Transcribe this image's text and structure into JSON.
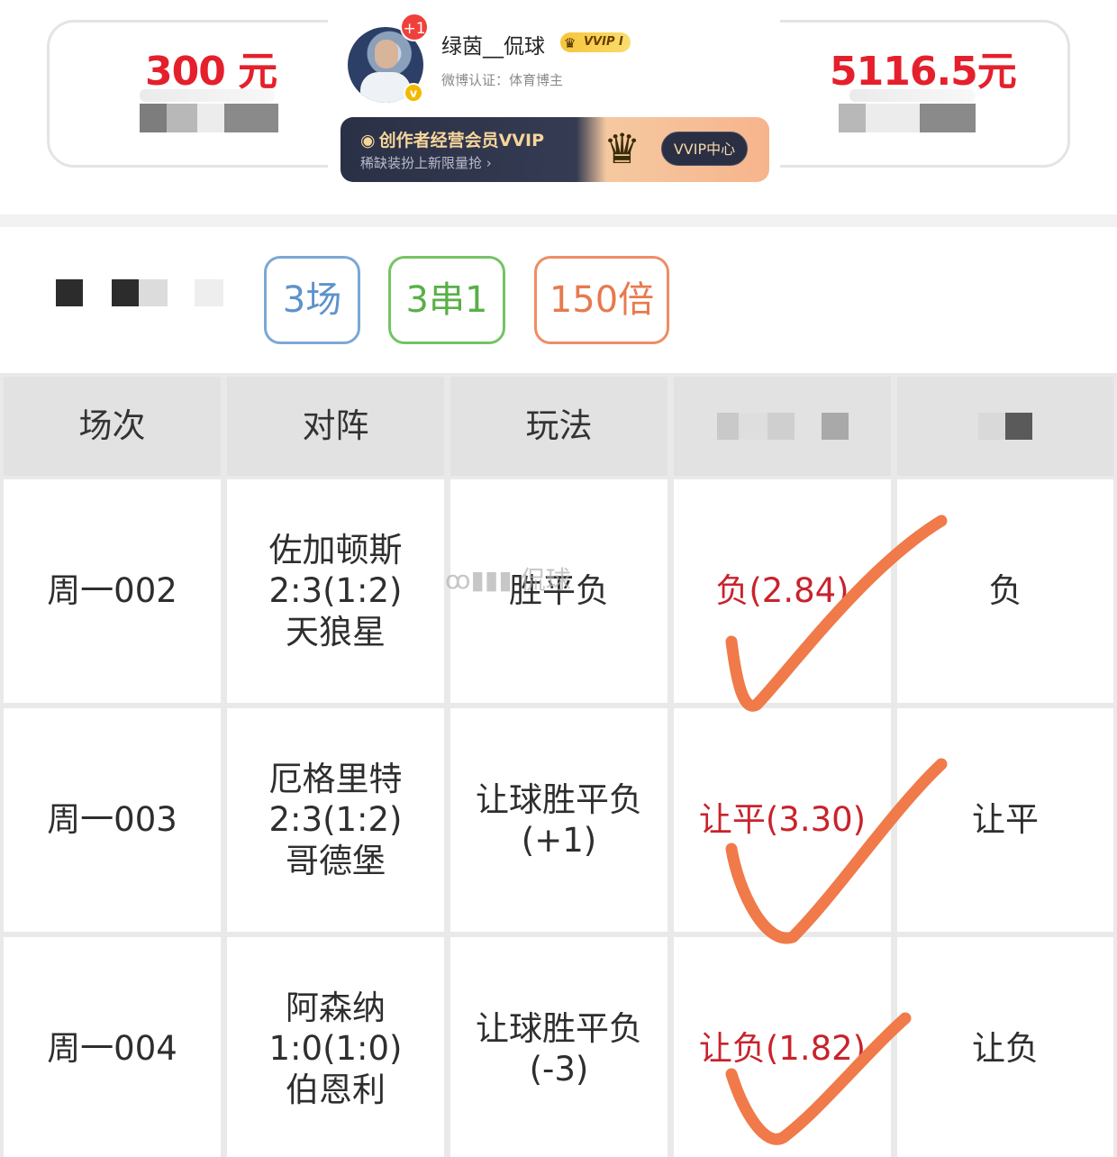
{
  "stats": {
    "left_value": "300 元",
    "right_value": "5116.5元"
  },
  "profile": {
    "username": "绿茵__侃球",
    "notification_count": "+1",
    "vvip_badge": "VVIP I",
    "verification": "微博认证：体育博主",
    "banner_title": "创作者经营会员VVIP",
    "banner_subtitle": "稀缺装扮上新限量抢 ›",
    "banner_button": "VVIP中心"
  },
  "tags": [
    "3场",
    "3串1",
    "150倍"
  ],
  "table": {
    "headers": [
      "场次",
      "对阵",
      "玩法",
      "",
      ""
    ],
    "rows": [
      {
        "match_no": "周一002",
        "home": "佐加顿斯",
        "score": "2:3(1:2)",
        "away": "天狼星",
        "play_line1": "胜平负",
        "play_line2": "",
        "pick": "负(2.84)",
        "result": "负"
      },
      {
        "match_no": "周一003",
        "home": "厄格里特",
        "score": "2:3(1:2)",
        "away": "哥德堡",
        "play_line1": "让球胜平负",
        "play_line2": "(+1)",
        "pick": "让平(3.30)",
        "result": "让平"
      },
      {
        "match_no": "周一004",
        "home": "阿森纳",
        "score": "1:0(1:0)",
        "away": "伯恩利",
        "play_line1": "让球胜平负",
        "play_line2": "(-3)",
        "pick": "让负(1.82)",
        "result": "让负"
      }
    ]
  },
  "watermark": "侃球",
  "colors": {
    "money_red": "#e4202c",
    "pick_red": "#c8232c",
    "check_orange": "#f07a4a",
    "tag_blue": "#5e92cb",
    "tag_green": "#5aaf48",
    "tag_orange": "#e67a4e"
  }
}
